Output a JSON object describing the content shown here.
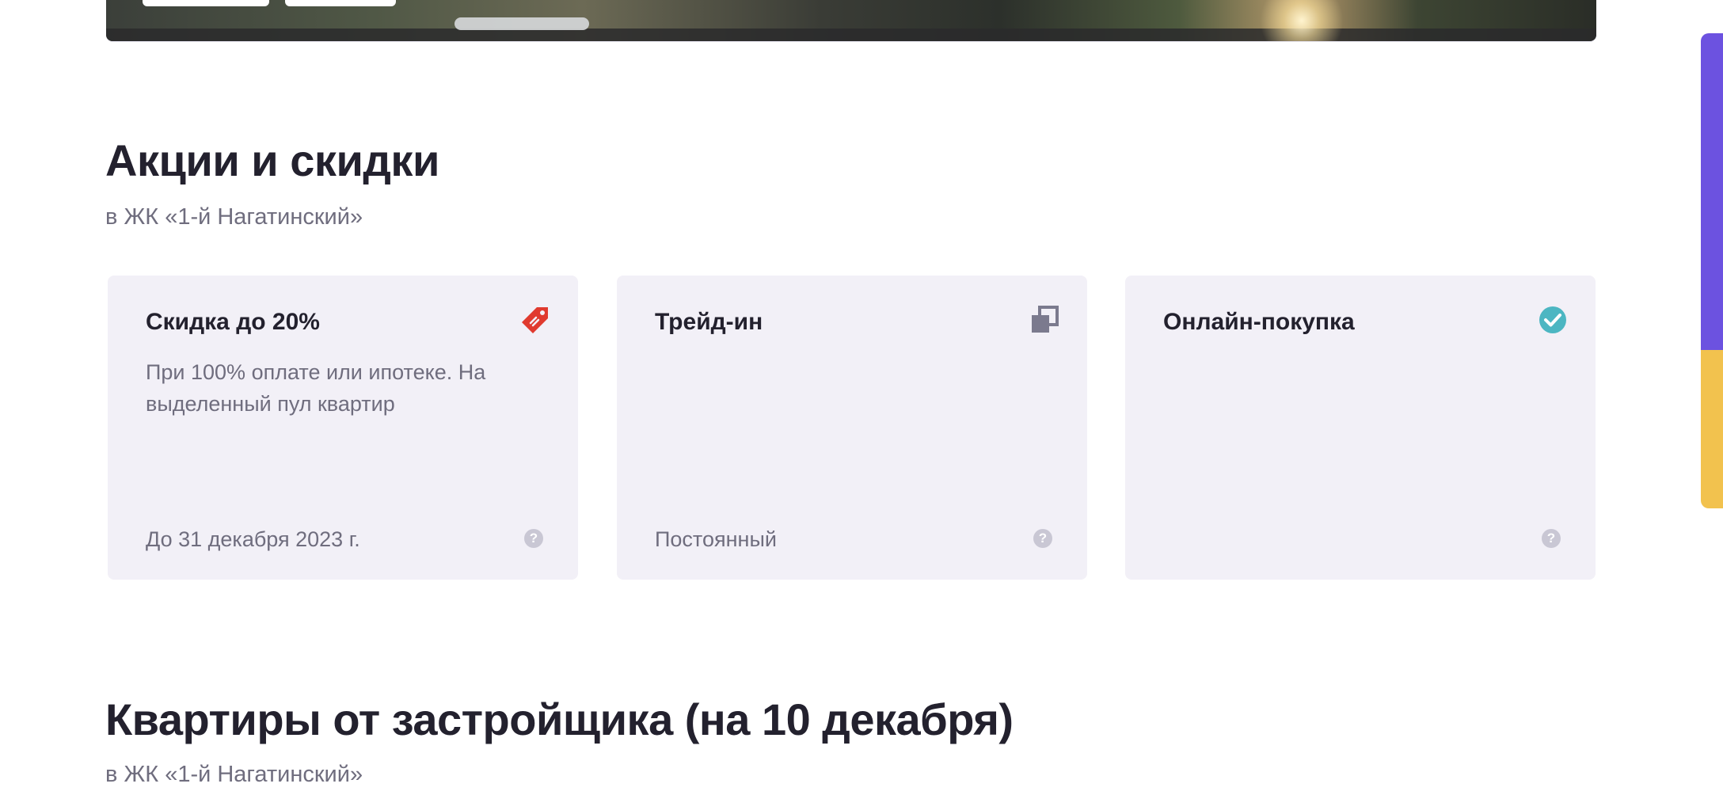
{
  "promos": {
    "title": "Акции и скидки",
    "subtitle": "в ЖК «1-й Нагатинский»",
    "cards": [
      {
        "title": "Скидка до 20%",
        "description": "При 100% оплате или ипотеке. На выделенный пул квартир",
        "date": "До 31 декабря 2023 г.",
        "icon": "price-tag-icon",
        "icon_color": "#e03a2f",
        "help": "?"
      },
      {
        "title": "Трейд-ин",
        "description": "",
        "date": "Постоянный",
        "icon": "trade-in-icon",
        "icon_color": "#7b7a8e",
        "help": "?"
      },
      {
        "title": "Онлайн-покупка",
        "description": "",
        "date": "",
        "icon": "check-circle-icon",
        "icon_color": "#4cb6c2",
        "help": "?"
      }
    ]
  },
  "apartments": {
    "title": "Квартиры от застройщика (на 10 декабря)",
    "subtitle": "в ЖК «1-й Нагатинский»"
  },
  "colors": {
    "background": "#ffffff",
    "card_background": "#f2f0f7",
    "text_primary": "#23212e",
    "text_secondary": "#6f6d7e",
    "side_purple": "#6c52e0",
    "side_yellow": "#f2c24e"
  }
}
